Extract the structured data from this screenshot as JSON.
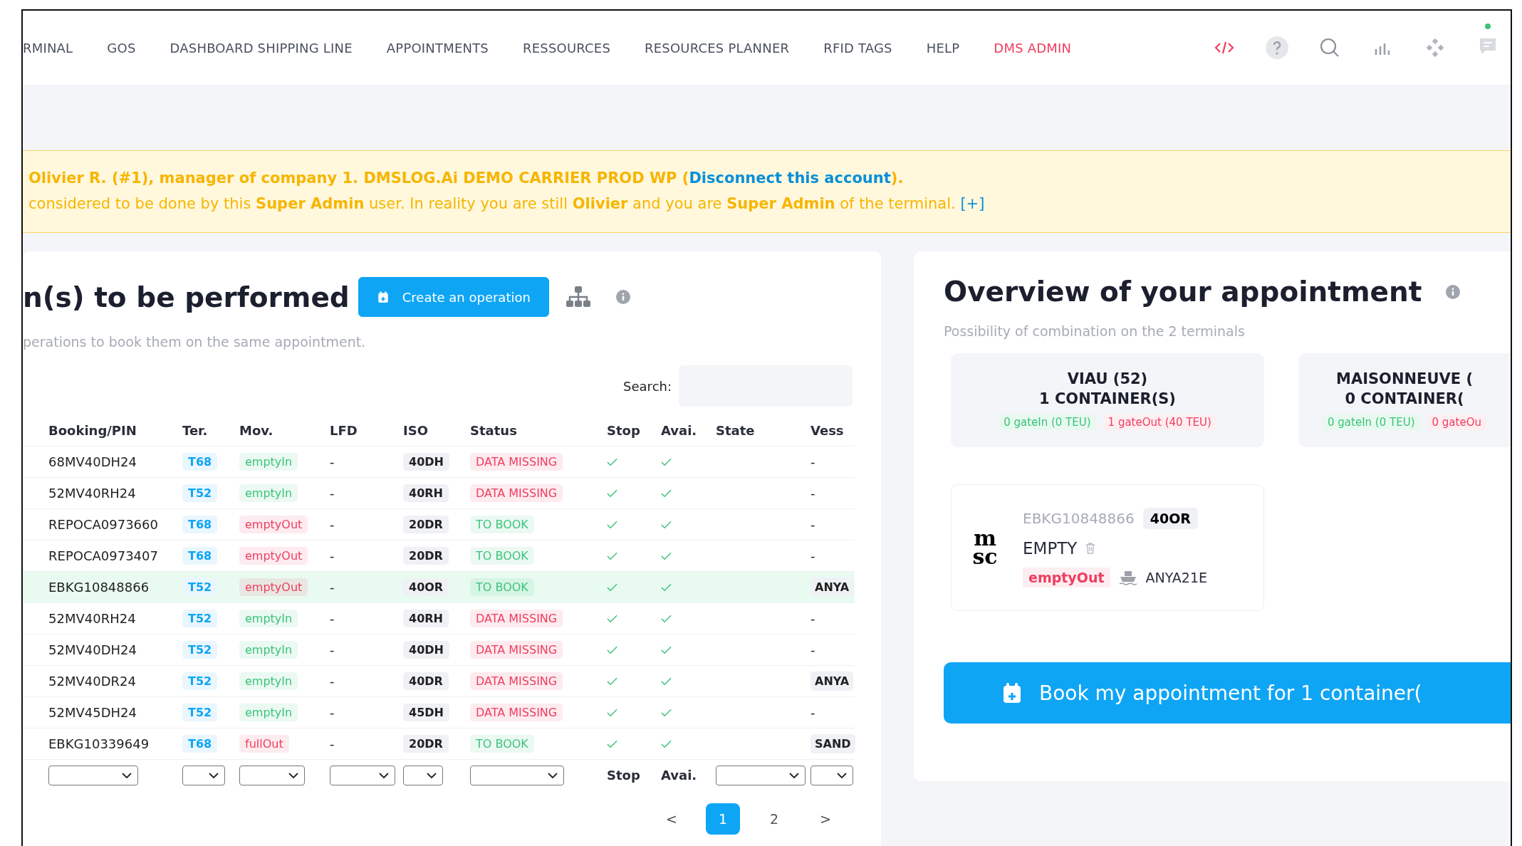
{
  "nav": {
    "items": [
      {
        "label": "RMINAL",
        "selected": false
      },
      {
        "label": "GOS",
        "selected": false
      },
      {
        "label": "DASHBOARD SHIPPING LINE",
        "selected": false
      },
      {
        "label": "APPOINTMENTS",
        "selected": false
      },
      {
        "label": "RESSOURCES",
        "selected": false
      },
      {
        "label": "RESOURCES PLANNER",
        "selected": false
      },
      {
        "label": "RFID TAGS",
        "selected": false
      },
      {
        "label": "HELP",
        "selected": false
      },
      {
        "label": "DMS ADMIN",
        "selected": true
      }
    ],
    "notification": true
  },
  "banner": {
    "line1": "Olivier R. (#1), manager of company 1. DMSLOG.Ai DEMO CARRIER PROD WP (",
    "link": "Disconnect this account",
    "line1_end": ").",
    "line2": "considered to be done by this **Super Admin** user. In reality you are still **Olivier** and you are **Super Admin** of the terminal.",
    "more": "[+]"
  },
  "operations": {
    "title": "n(s) to be performed",
    "create_button": "Create an operation",
    "subtitle": "perations to book them on the same appointment.",
    "search_label": "Search:",
    "columns": [
      "Booking/PIN",
      "Ter.",
      "Mov.",
      "LFD",
      "ISO",
      "Status",
      "Stop",
      "Avai.",
      "State",
      "Vess"
    ],
    "rows": [
      {
        "booking": "68MV40DH24",
        "ter": "T68",
        "mov": {
          "label": "emptyIn",
          "color": "#3cc37c"
        },
        "lfd": "-",
        "iso": "40DH",
        "status": {
          "label": "DATA MISSING",
          "color": "#ef3e5f"
        },
        "stop": true,
        "avai": true,
        "vessel": "-",
        "selected": false
      },
      {
        "booking": "52MV40RH24",
        "ter": "T52",
        "mov": {
          "label": "emptyIn",
          "color": "#3cc37c"
        },
        "lfd": "-",
        "iso": "40RH",
        "status": {
          "label": "DATA MISSING",
          "color": "#ef3e5f"
        },
        "stop": true,
        "avai": true,
        "vessel": "-",
        "selected": false
      },
      {
        "booking": "REPOCA0973660",
        "ter": "T68",
        "mov": {
          "label": "emptyOut",
          "color": "#ef3e5f"
        },
        "lfd": "-",
        "iso": "20DR",
        "status": {
          "label": "TO BOOK",
          "color": "#3cc37c"
        },
        "stop": true,
        "avai": true,
        "vessel": "-",
        "selected": false
      },
      {
        "booking": "REPOCA0973407",
        "ter": "T68",
        "mov": {
          "label": "emptyOut",
          "color": "#ef3e5f"
        },
        "lfd": "-",
        "iso": "20DR",
        "status": {
          "label": "TO BOOK",
          "color": "#3cc37c"
        },
        "stop": true,
        "avai": true,
        "vessel": "-",
        "selected": false
      },
      {
        "booking": "EBKG10848866",
        "ter": "T52",
        "mov": {
          "label": "emptyOut",
          "color": "#ef3e5f"
        },
        "lfd": "-",
        "iso": "40OR",
        "status": {
          "label": "TO BOOK",
          "color": "#3cc37c"
        },
        "stop": true,
        "avai": true,
        "vessel": "ANYA",
        "selected": true
      },
      {
        "booking": "52MV40RH24",
        "ter": "T52",
        "mov": {
          "label": "emptyIn",
          "color": "#3cc37c"
        },
        "lfd": "-",
        "iso": "40RH",
        "status": {
          "label": "DATA MISSING",
          "color": "#ef3e5f"
        },
        "stop": true,
        "avai": true,
        "vessel": "-",
        "selected": false
      },
      {
        "booking": "52MV40DH24",
        "ter": "T52",
        "mov": {
          "label": "emptyIn",
          "color": "#3cc37c"
        },
        "lfd": "-",
        "iso": "40DH",
        "status": {
          "label": "DATA MISSING",
          "color": "#ef3e5f"
        },
        "stop": true,
        "avai": true,
        "vessel": "-",
        "selected": false
      },
      {
        "booking": "52MV40DR24",
        "ter": "T52",
        "mov": {
          "label": "emptyIn",
          "color": "#3cc37c"
        },
        "lfd": "-",
        "iso": "40DR",
        "status": {
          "label": "DATA MISSING",
          "color": "#ef3e5f"
        },
        "stop": true,
        "avai": true,
        "vessel": "ANYA",
        "selected": false
      },
      {
        "booking": "52MV45DH24",
        "ter": "T52",
        "mov": {
          "label": "emptyIn",
          "color": "#3cc37c"
        },
        "lfd": "-",
        "iso": "45DH",
        "status": {
          "label": "DATA MISSING",
          "color": "#ef3e5f"
        },
        "stop": true,
        "avai": true,
        "vessel": "-",
        "selected": false
      },
      {
        "booking": "EBKG10339649",
        "ter": "T68",
        "mov": {
          "label": "fullOut",
          "color": "#ef3e5f"
        },
        "lfd": "-",
        "iso": "20DR",
        "status": {
          "label": "TO BOOK",
          "color": "#3cc37c"
        },
        "stop": true,
        "avai": true,
        "vessel": "SAND",
        "selected": false
      }
    ],
    "filters": [
      {
        "kind": "select"
      },
      {
        "kind": "select"
      },
      {
        "kind": "select"
      },
      {
        "kind": "select"
      },
      {
        "kind": "select"
      },
      {
        "kind": "select"
      },
      {
        "kind": "label",
        "label": "Stop"
      },
      {
        "kind": "label",
        "label": "Avai."
      },
      {
        "kind": "select"
      },
      {
        "kind": "select"
      }
    ],
    "pagination": [
      {
        "label": "<",
        "selected": false
      },
      {
        "label": "1",
        "selected": true
      },
      {
        "label": "2",
        "selected": false
      },
      {
        "label": ">",
        "selected": false
      }
    ]
  },
  "overview": {
    "title": "Overview of your appointment",
    "subtitle": "Possibility of combination on the 2 terminals",
    "terminals": [
      {
        "name": "VIAU (52)",
        "containers": "1 CONTAINER(S)",
        "gatein": "0 gateIn (0 TEU)",
        "gateout": "1 gateOut (40 TEU)"
      },
      {
        "name": "MAISONNEUVE (",
        "containers": "0 CONTAINER(",
        "gatein": "0 gateIn (0 TEU)",
        "gateout": "0 gateOu"
      }
    ],
    "container": {
      "logo_lines": [
        "m",
        "sc"
      ],
      "booking": "EBKG10848866",
      "iso": "40OR",
      "type": "EMPTY",
      "mov": "emptyOut",
      "vessel": "ANYA21E"
    },
    "book_button": "Book my appointment for 1 container("
  }
}
